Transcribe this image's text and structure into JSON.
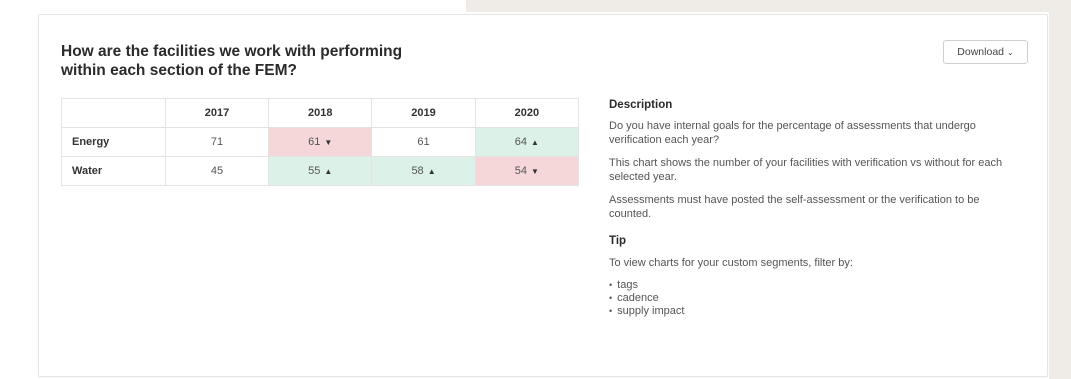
{
  "card": {
    "title": "How are the facilities we work with performing\nwithin each section of the FEM?",
    "download_label": "Download"
  },
  "table": {
    "headers": [
      "",
      "2017",
      "2018",
      "2019",
      "2020"
    ],
    "rows": [
      {
        "label": "Energy",
        "cells": [
          {
            "value": "71",
            "trend": "none"
          },
          {
            "value": "61",
            "trend": "down"
          },
          {
            "value": "61",
            "trend": "none"
          },
          {
            "value": "64",
            "trend": "up"
          }
        ]
      },
      {
        "label": "Water",
        "cells": [
          {
            "value": "45",
            "trend": "none"
          },
          {
            "value": "55",
            "trend": "up"
          },
          {
            "value": "58",
            "trend": "up"
          },
          {
            "value": "54",
            "trend": "down"
          }
        ]
      }
    ]
  },
  "description": {
    "heading": "Description",
    "paragraphs": [
      "Do you have internal goals for the percentage of assessments that undergo verification each year?",
      "This chart shows the number of your facilities with verification vs without for each selected year.",
      "Assessments must have posted the self-assessment or the verification to be counted."
    ]
  },
  "tip": {
    "heading": "Tip",
    "text": "To view charts for your custom segments, filter by:",
    "items": [
      "tags",
      "cadence",
      "supply impact"
    ]
  },
  "colors": {
    "up_cell": "#dcf1e7",
    "down_cell": "#f6d7d9",
    "page_bg": "#efebe6"
  },
  "icons": {
    "up": "triangle-up",
    "down": "triangle-down",
    "download_chevron": "chevron-down"
  }
}
